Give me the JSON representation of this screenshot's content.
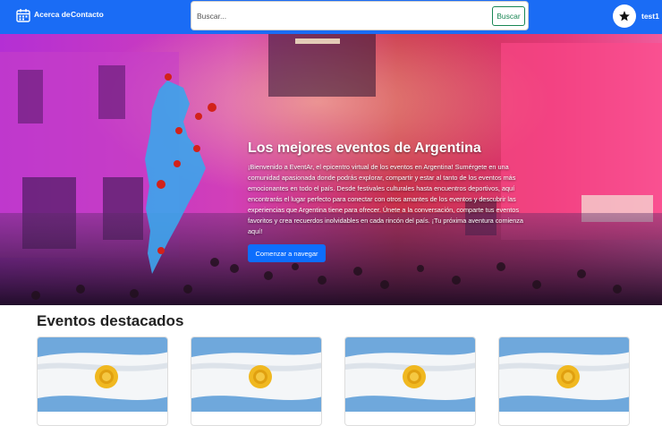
{
  "navbar": {
    "brand_icon": "calendar-icon",
    "about_label": "Acerca de",
    "contact_label": "Contacto",
    "search_placeholder": "Buscar...",
    "search_button_label": "Buscar",
    "avatar_icon": "star-icon",
    "username": "test1",
    "colors": {
      "navbar_bg": "#1a6cf5",
      "search_button": "#198754"
    }
  },
  "hero": {
    "title": "Los mejores eventos de Argentina",
    "text": "¡Bienvenido a EventAr, el epicentro virtual de los eventos en Argentina! Sumérgete en una comunidad apasionada donde podrás explorar, compartir y estar al tanto de los eventos más emocionantes en todo el país. Desde festivales culturales hasta encuentros deportivos, aquí encontrarás el lugar perfecto para conectar con otros amantes de los eventos y descubrir las experiencias que Argentina tiene para ofrecer. Únete a la conversación, comparte tus eventos favoritos y crea recuerdos inolvidables en cada rincón del país. ¡Tu próxima aventura comienza aquí!",
    "button_label": "Comenzar a navegar",
    "button_color": "#0d6efd"
  },
  "featured": {
    "title": "Eventos destacados",
    "cards": [
      {
        "image": "argentina-flag"
      },
      {
        "image": "argentina-flag"
      },
      {
        "image": "argentina-flag"
      },
      {
        "image": "argentina-flag"
      }
    ]
  }
}
